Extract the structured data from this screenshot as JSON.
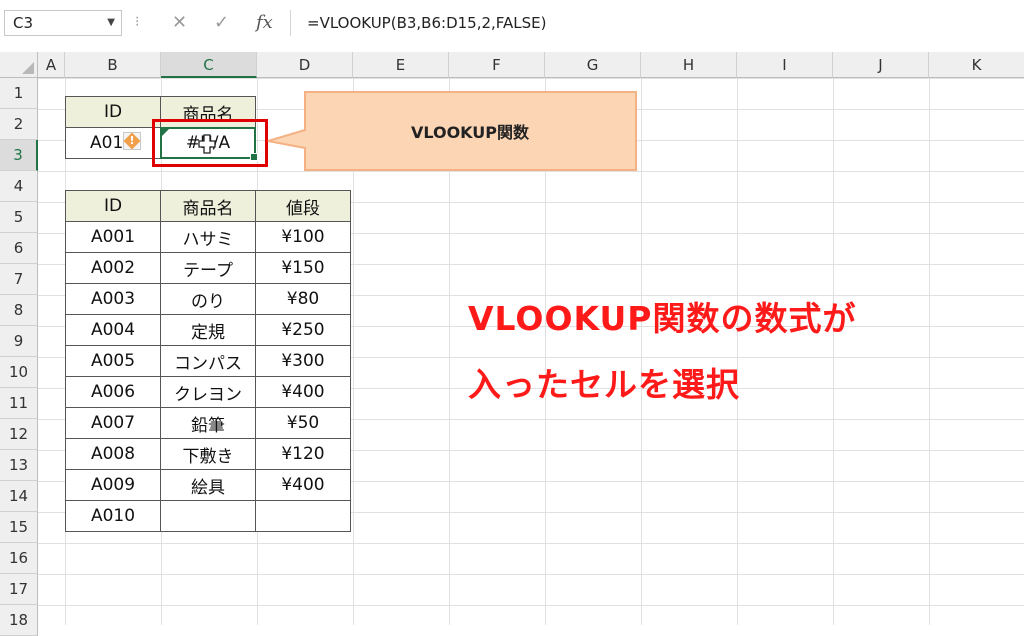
{
  "formula_bar": {
    "name_box": "C3",
    "cancel_icon": "✕",
    "enter_icon": "✓",
    "fx_label": "fx",
    "formula": "=VLOOKUP(B3,B6:D15,2,FALSE)"
  },
  "columns": [
    "A",
    "B",
    "C",
    "D",
    "E",
    "F",
    "G",
    "H",
    "I",
    "J",
    "K"
  ],
  "rows": [
    "1",
    "2",
    "3",
    "4",
    "5",
    "6",
    "7",
    "8",
    "9",
    "10",
    "11",
    "12",
    "13",
    "14",
    "15",
    "16",
    "17",
    "18"
  ],
  "lookup": {
    "id_header": "ID",
    "name_header": "商品名",
    "id_value": "A01",
    "result": "#N/A"
  },
  "table": {
    "headers": [
      "ID",
      "商品名",
      "値段"
    ],
    "rows": [
      [
        "A001",
        "ハサミ",
        "¥100"
      ],
      [
        "A002",
        "テープ",
        "¥150"
      ],
      [
        "A003",
        "のり",
        "¥80"
      ],
      [
        "A004",
        "定規",
        "¥250"
      ],
      [
        "A005",
        "コンパス",
        "¥300"
      ],
      [
        "A006",
        "クレヨン",
        "¥400"
      ],
      [
        "A007",
        "鉛筆",
        "¥50"
      ],
      [
        "A008",
        "下敷き",
        "¥120"
      ],
      [
        "A009",
        "絵具",
        "¥400"
      ],
      [
        "A010",
        "",
        ""
      ]
    ]
  },
  "callout": {
    "text": "VLOOKUP関数"
  },
  "annotation": {
    "line1": "VLOOKUP関数の数式が",
    "line2": "入ったセルを選択"
  },
  "colors": {
    "accent_green": "#217346",
    "highlight_red": "#e00000",
    "callout_fill": "#fcd5b5",
    "callout_border": "#f4b183"
  }
}
